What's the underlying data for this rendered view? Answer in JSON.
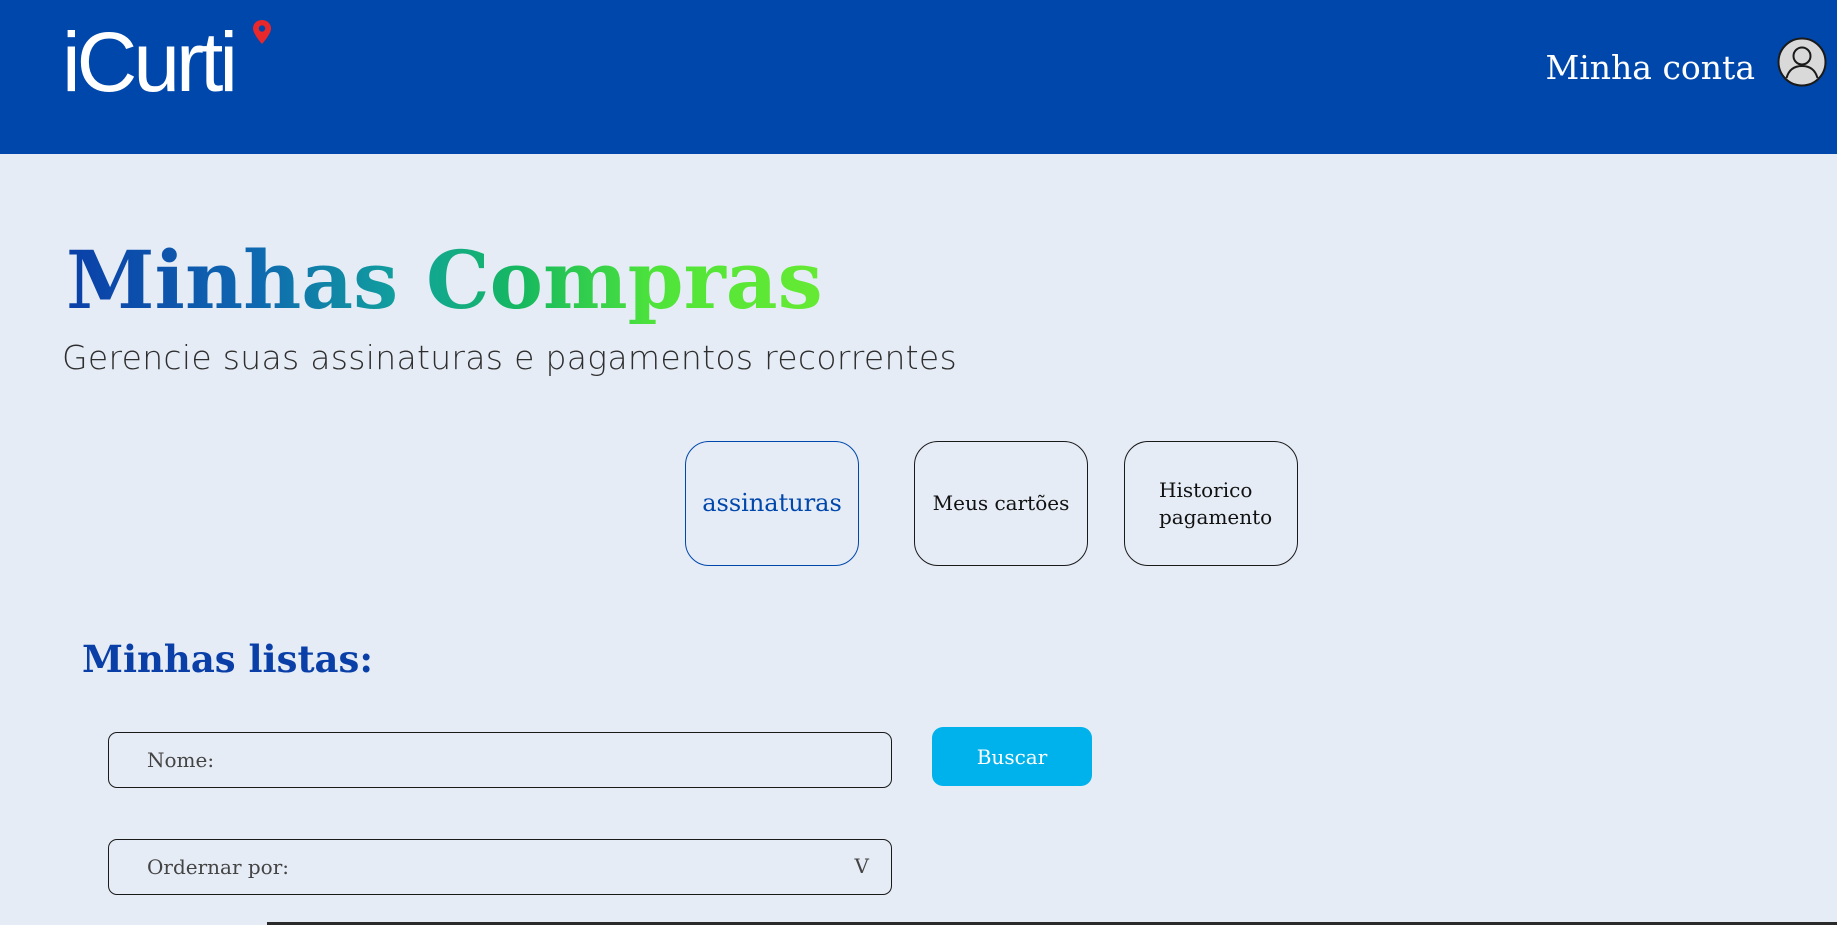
{
  "header": {
    "logo_text": "iCurti",
    "account_label": "Minha conta",
    "avatar_icon": "user-circle-icon",
    "pin_icon": "location-pin-icon",
    "colors": {
      "bar": "#0047ab",
      "pin": "#e8282b"
    }
  },
  "page": {
    "title": "Minhas Compras",
    "subtitle": "Gerencie suas assinaturas e pagamentos recorrentes",
    "title_gradient": [
      "#0a3fa8",
      "#11a39c",
      "#66ea33"
    ]
  },
  "tabs": [
    {
      "label": "assinaturas",
      "active": true
    },
    {
      "label": "Meus cartões",
      "active": false
    },
    {
      "label": "Historico pagamento",
      "active": false
    }
  ],
  "lists": {
    "heading": "Minhas listas:",
    "name_field_label": "Nome:",
    "search_button": "Buscar",
    "sort_label": "Ordernar por:",
    "sort_chevron": "V"
  },
  "colors": {
    "background": "#e5ecf6",
    "accent": "#0047ab",
    "button": "#00b2ec"
  }
}
